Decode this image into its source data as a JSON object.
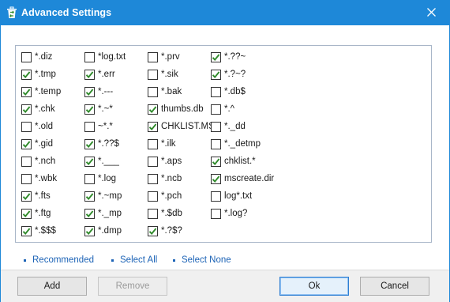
{
  "window": {
    "title": "Advanced Settings",
    "icons": {
      "app": "recycle-bin-icon",
      "close": "close-icon",
      "check": "checkmark-icon"
    },
    "colors": {
      "titlebar": "#1e88d8",
      "link": "#1c63b6",
      "checkmark": "#2f8a2a"
    }
  },
  "columns": [
    [
      {
        "label": "*.diz",
        "checked": false
      },
      {
        "label": "*.tmp",
        "checked": true
      },
      {
        "label": "*.temp",
        "checked": true
      },
      {
        "label": "*.chk",
        "checked": true
      },
      {
        "label": "*.old",
        "checked": false
      },
      {
        "label": "*.gid",
        "checked": true
      },
      {
        "label": "*.nch",
        "checked": false
      },
      {
        "label": "*.wbk",
        "checked": false
      },
      {
        "label": "*.fts",
        "checked": true
      },
      {
        "label": "*.ftg",
        "checked": true
      },
      {
        "label": "*.$$$",
        "checked": true
      }
    ],
    [
      {
        "label": "*log.txt",
        "checked": false
      },
      {
        "label": "*.err",
        "checked": true
      },
      {
        "label": "*.---",
        "checked": true
      },
      {
        "label": "*.~*",
        "checked": true
      },
      {
        "label": "~*.*",
        "checked": false
      },
      {
        "label": "*.??$",
        "checked": true
      },
      {
        "label": "*.___",
        "checked": true
      },
      {
        "label": "*.log",
        "checked": false
      },
      {
        "label": "*.~mp",
        "checked": true
      },
      {
        "label": "*._mp",
        "checked": true
      },
      {
        "label": "*.dmp",
        "checked": true
      }
    ],
    [
      {
        "label": "*.prv",
        "checked": false
      },
      {
        "label": "*.sik",
        "checked": false
      },
      {
        "label": "*.bak",
        "checked": false
      },
      {
        "label": "thumbs.db",
        "checked": true
      },
      {
        "label": "CHKLIST.MS",
        "checked": true
      },
      {
        "label": "*.ilk",
        "checked": false
      },
      {
        "label": "*.aps",
        "checked": false
      },
      {
        "label": "*.ncb",
        "checked": false
      },
      {
        "label": "*.pch",
        "checked": false
      },
      {
        "label": "*.$db",
        "checked": false
      },
      {
        "label": "*.?$?",
        "checked": true
      }
    ],
    [
      {
        "label": "*.??~",
        "checked": true
      },
      {
        "label": "*.?~?",
        "checked": true
      },
      {
        "label": "*.db$",
        "checked": false
      },
      {
        "label": "*.^",
        "checked": false
      },
      {
        "label": "*._dd",
        "checked": false
      },
      {
        "label": "*._detmp",
        "checked": false
      },
      {
        "label": "chklist.*",
        "checked": true
      },
      {
        "label": "mscreate.dir",
        "checked": true
      },
      {
        "label": "log*.txt",
        "checked": false
      },
      {
        "label": "*.log?",
        "checked": false
      }
    ]
  ],
  "links": {
    "recommended": "Recommended",
    "select_all": "Select All",
    "select_none": "Select None"
  },
  "buttons": {
    "add": "Add",
    "remove": "Remove",
    "ok": "Ok",
    "cancel": "Cancel"
  }
}
